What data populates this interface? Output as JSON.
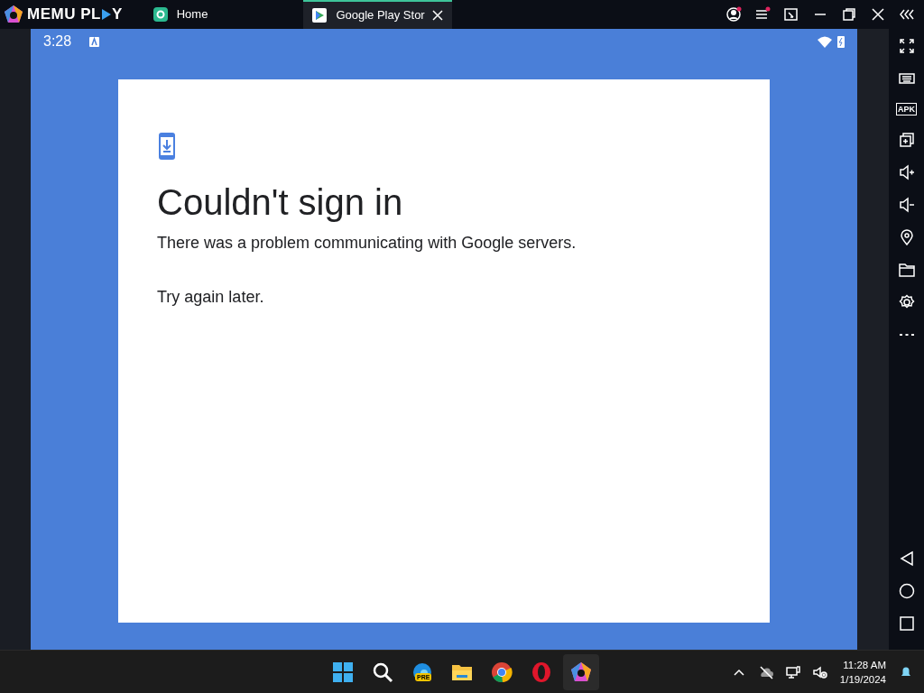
{
  "app": {
    "logo_parts": [
      "MEMU PL",
      "Y"
    ]
  },
  "tabs": [
    {
      "label": "Home",
      "selected": false,
      "kind": "home"
    },
    {
      "label": "Google Play Stor",
      "selected": true,
      "kind": "play",
      "closable": true
    }
  ],
  "status_bar": {
    "time": "3:28"
  },
  "dialog": {
    "title": "Couldn't sign in",
    "message": "There was a problem communicating with Google servers.",
    "hint": "Try again later."
  },
  "sidebar": {
    "apk_label": "APK"
  },
  "taskbar": {
    "edge_badge": "PRE",
    "time": "11:28 AM",
    "date": "1/19/2024"
  }
}
